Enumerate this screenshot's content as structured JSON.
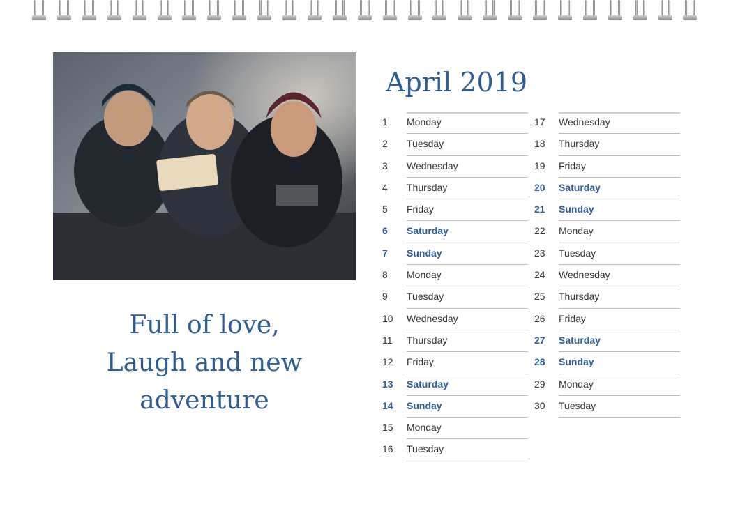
{
  "month_title": "April 2019",
  "caption": {
    "line1": "Full of love,",
    "line2": "Laugh and new",
    "line3": "adventure"
  },
  "colors": {
    "accent": "#2f5d92",
    "text": "#333333",
    "rule": "#bcbcbc"
  },
  "photo": {
    "icon": "photo-three-friends-selfie"
  },
  "days_left": [
    {
      "num": "1",
      "day": "Monday",
      "weekend": false
    },
    {
      "num": "2",
      "day": "Tuesday",
      "weekend": false
    },
    {
      "num": "3",
      "day": "Wednesday",
      "weekend": false
    },
    {
      "num": "4",
      "day": "Thursday",
      "weekend": false
    },
    {
      "num": "5",
      "day": "Friday",
      "weekend": false
    },
    {
      "num": "6",
      "day": "Saturday",
      "weekend": true
    },
    {
      "num": "7",
      "day": "Sunday",
      "weekend": true
    },
    {
      "num": "8",
      "day": "Monday",
      "weekend": false
    },
    {
      "num": "9",
      "day": "Tuesday",
      "weekend": false
    },
    {
      "num": "10",
      "day": "Wednesday",
      "weekend": false
    },
    {
      "num": "11",
      "day": "Thursday",
      "weekend": false
    },
    {
      "num": "12",
      "day": "Friday",
      "weekend": false
    },
    {
      "num": "13",
      "day": "Saturday",
      "weekend": true
    },
    {
      "num": "14",
      "day": "Sunday",
      "weekend": true
    },
    {
      "num": "15",
      "day": "Monday",
      "weekend": false
    },
    {
      "num": "16",
      "day": "Tuesday",
      "weekend": false
    }
  ],
  "days_right": [
    {
      "num": "17",
      "day": "Wednesday",
      "weekend": false
    },
    {
      "num": "18",
      "day": "Thursday",
      "weekend": false
    },
    {
      "num": "19",
      "day": "Friday",
      "weekend": false
    },
    {
      "num": "20",
      "day": "Saturday",
      "weekend": true
    },
    {
      "num": "21",
      "day": "Sunday",
      "weekend": true
    },
    {
      "num": "22",
      "day": "Monday",
      "weekend": false
    },
    {
      "num": "23",
      "day": "Tuesday",
      "weekend": false
    },
    {
      "num": "24",
      "day": "Wednesday",
      "weekend": false
    },
    {
      "num": "25",
      "day": "Thursday",
      "weekend": false
    },
    {
      "num": "26",
      "day": "Friday",
      "weekend": false
    },
    {
      "num": "27",
      "day": "Saturday",
      "weekend": true
    },
    {
      "num": "28",
      "day": "Sunday",
      "weekend": true
    },
    {
      "num": "29",
      "day": "Monday",
      "weekend": false
    },
    {
      "num": "30",
      "day": "Tuesday",
      "weekend": false
    }
  ]
}
